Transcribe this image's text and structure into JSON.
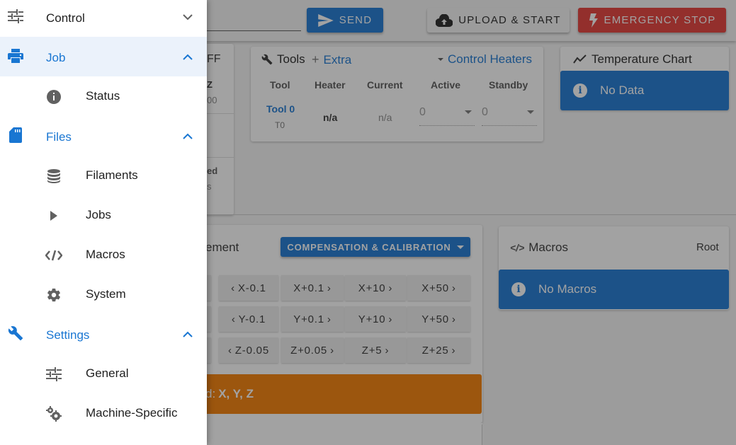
{
  "topbar": {
    "send_label": "SEND",
    "upload_label": "UPLOAD & START",
    "estop_label": "EMERGENCY STOP"
  },
  "background": {
    "left_fragments": {
      "a": "FF",
      "b": "Z",
      "c": "00",
      "d": "ed",
      "e": "s"
    },
    "tools": {
      "title": "Tools",
      "extra": "Extra",
      "control_heaters": "Control Heaters",
      "columns": [
        "Tool",
        "Heater",
        "Current",
        "Active",
        "Standby"
      ],
      "row": {
        "tool": "Tool 0",
        "tool_sub": "T0",
        "heater": "n/a",
        "current": "n/a",
        "active": "0",
        "standby": "0"
      }
    },
    "temperature": {
      "title": "Temperature Chart",
      "banner": "No Data"
    },
    "movement": {
      "title_fragment": "ement",
      "compensation_label": "COMPENSATION & CALIBRATION",
      "jog_rows": [
        [
          "X-0.1",
          "X+0.1",
          "X+10",
          "X+50"
        ],
        [
          "Y-0.1",
          "Y+0.1",
          "Y+10",
          "Y+50"
        ],
        [
          "Z-0.05",
          "Z+0.05",
          "Z+5",
          "Z+25"
        ]
      ],
      "warning_prefix": "d:",
      "warning_axes": "X, Y, Z"
    },
    "macros": {
      "title": "Macros",
      "root": "Root",
      "banner": "No Macros"
    }
  },
  "drawer": {
    "control": "Control",
    "job": "Job",
    "job_items": {
      "status": "Status"
    },
    "files": "Files",
    "files_items": {
      "filaments": "Filaments",
      "jobs": "Jobs",
      "macros": "Macros",
      "system": "System"
    },
    "settings": "Settings",
    "settings_items": {
      "general": "General",
      "machine_specific": "Machine-Specific"
    }
  },
  "colors": {
    "primary": "#1976d2",
    "danger": "#e53935",
    "warning": "#f57c00",
    "drawer_active_bg": "#ebf2fb"
  }
}
